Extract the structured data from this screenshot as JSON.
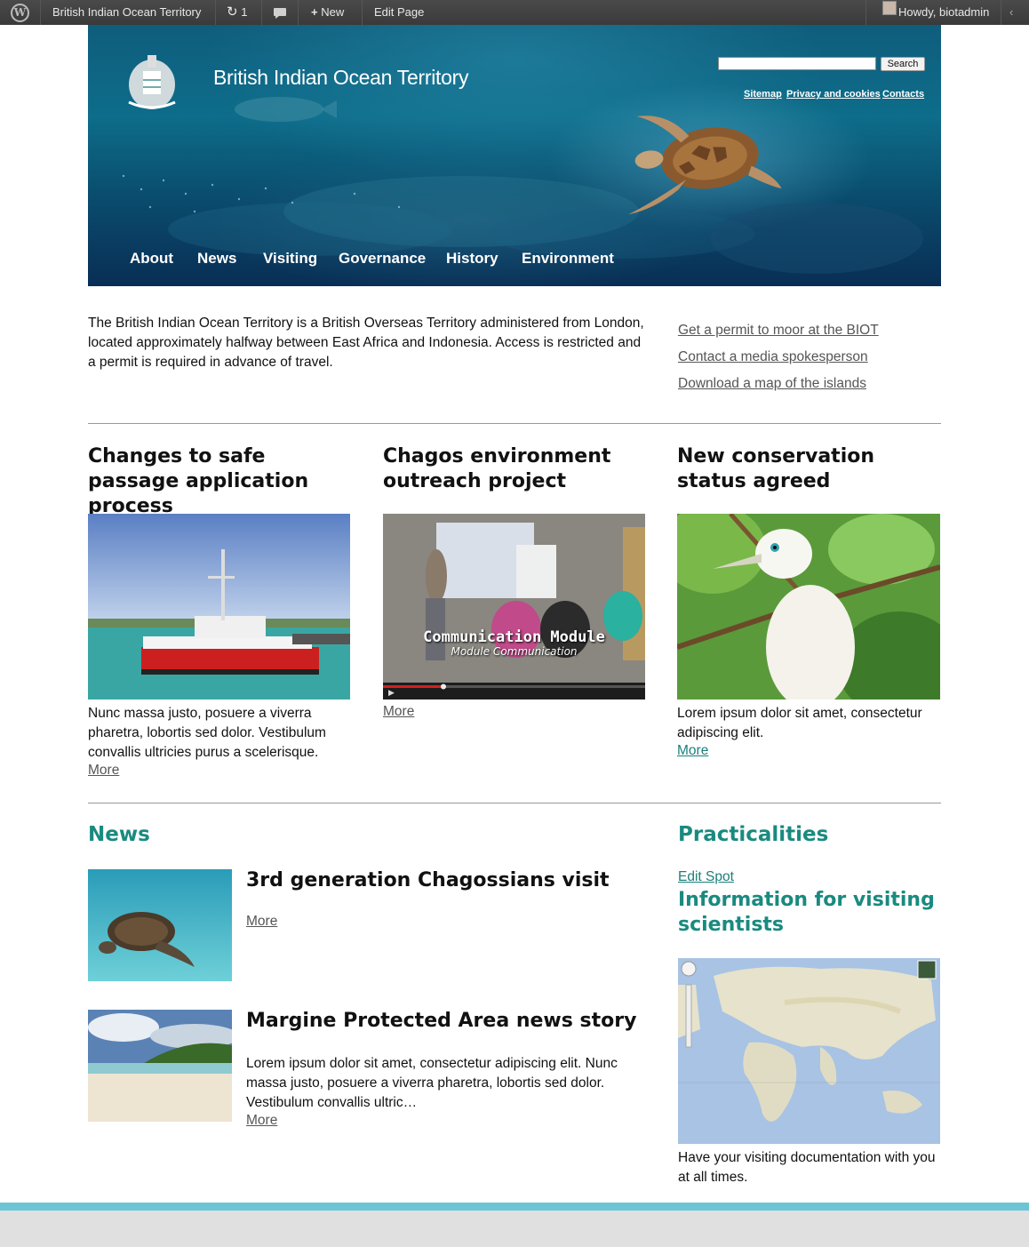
{
  "admin_bar": {
    "logo_glyph": "W",
    "site_name": "British Indian Ocean Territory",
    "updates_count": "1",
    "updates_icon": "refresh-icon",
    "comments_icon": "comment-icon",
    "new_label": "New",
    "edit_label": "Edit Page",
    "greeting": "Howdy, biotadmin"
  },
  "header": {
    "title": "British Indian Ocean Territory",
    "search_placeholder": "",
    "search_button": "Search",
    "utility_links": [
      "Sitemap",
      "Privacy and cookies",
      "Contacts"
    ],
    "nav": [
      "About",
      "News",
      "Visiting",
      "Governance",
      "History",
      "Environment"
    ]
  },
  "intro": {
    "text": "The British Indian Ocean Territory is a British Overseas Territory administered from London, located approximately halfway between East Africa and Indonesia. Access is restricted and a permit is required in advance of travel.",
    "quick_links": [
      "Get a permit to moor at the BIOT",
      "Contact a media spokesperson",
      "Download a map of the islands"
    ]
  },
  "features": [
    {
      "title": "Changes to safe passage application process",
      "text": "Nunc massa justo, posuere a viverra pharetra, lobortis sed dolor. Vestibulum convallis ultricies purus a scelerisque.",
      "more": "More"
    },
    {
      "title": "Chagos environment outreach project",
      "video_caption": "Communication Module",
      "video_subcaption": "Module Communication",
      "more": "More"
    },
    {
      "title": "New conservation status agreed",
      "text": "Lorem ipsum dolor sit amet, consectetur adipiscing elit.",
      "more": "More"
    }
  ],
  "news": {
    "heading": "News",
    "items": [
      {
        "title": "3rd generation Chagossians visit",
        "text": "",
        "more": "More"
      },
      {
        "title": "Margine Protected Area news story",
        "text": "Lorem ipsum dolor sit amet, consectetur adipiscing elit. Nunc massa justo, posuere a viverra pharetra, lobortis sed dolor. Vestibulum convallis ultric…",
        "more": "More"
      }
    ]
  },
  "practicalities": {
    "heading": "Practicalities",
    "edit_link": "Edit Spot",
    "spot_title": "Information for visiting scientists",
    "text": "Have your visiting documentation with you at all times."
  },
  "colors": {
    "accent_teal": "#1a8a80",
    "footer_bar": "#6cc5d4",
    "admin_bar": "#464646"
  }
}
